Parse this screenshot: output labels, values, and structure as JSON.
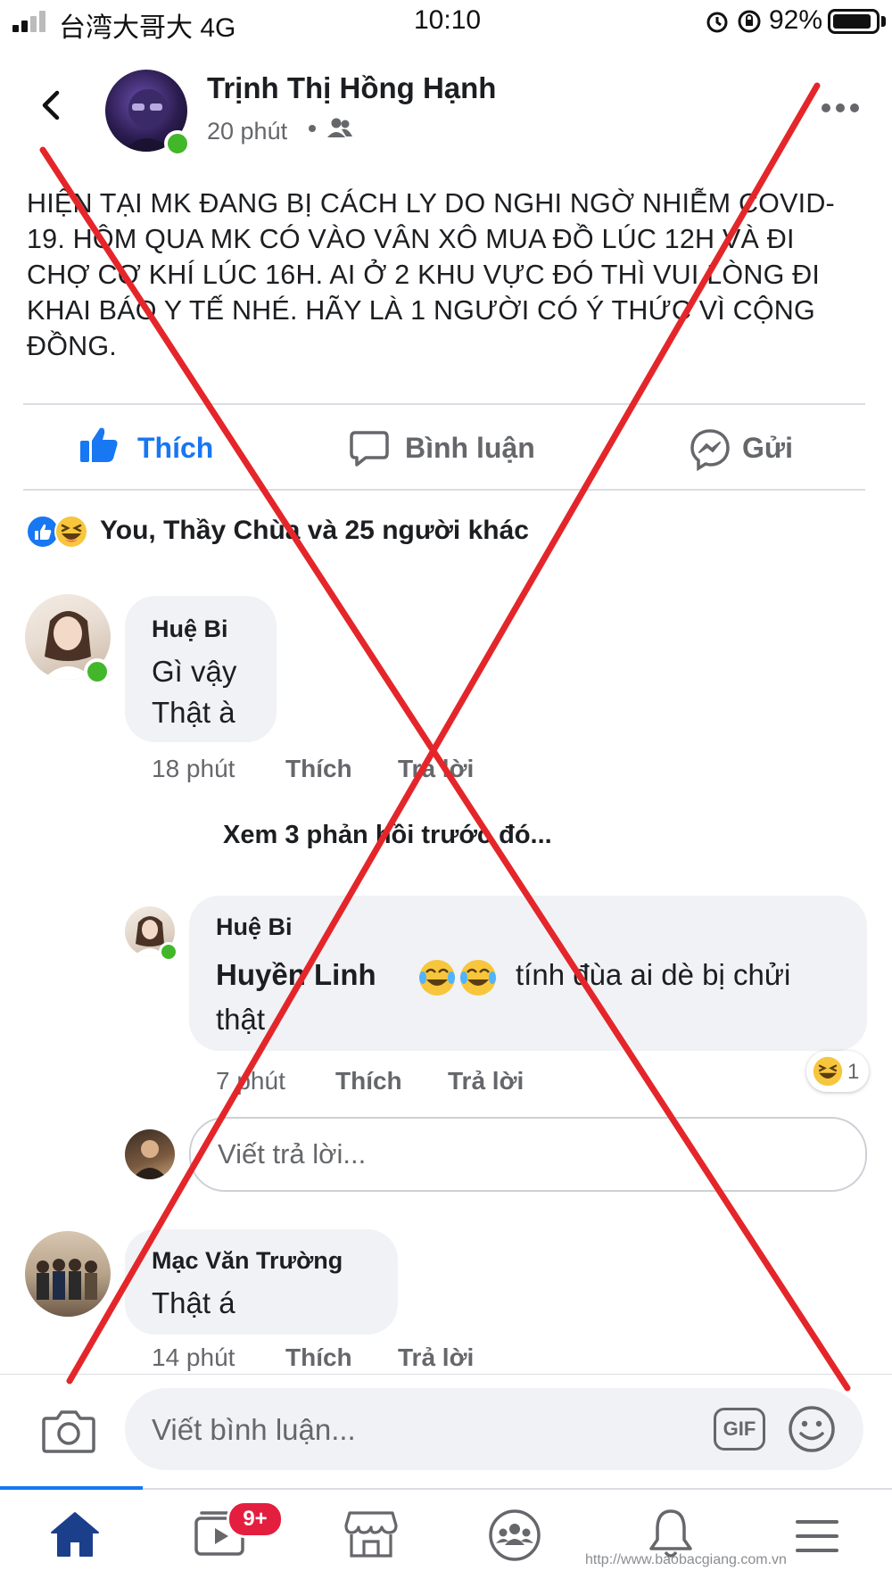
{
  "status_bar": {
    "carrier": "台湾大哥大 4G",
    "time": "10:10",
    "battery": "92%",
    "battery_level": 0.92
  },
  "post": {
    "author": "Trịnh Thị Hồng Hạnh",
    "time": "20 phút",
    "audience_icon": "friends-icon",
    "text": "HIỆN TẠI MK ĐANG BỊ CÁCH LY DO NGHI NGỜ NHIỄM COVID-19. HÔM QUA MK CÓ VÀO VÂN XÔ MUA ĐỒ LÚC 12H VÀ ĐI CHỢ CƠ KHÍ LÚC 16H. AI Ở 2 KHU VỰC ĐÓ THÌ VUI LÒNG ĐI KHAI BÁO Y TẾ NHÉ. HÃY LÀ 1 NGƯỜI CÓ Ý THỨC VÌ CỘNG ĐỒNG."
  },
  "actions": {
    "like": "Thích",
    "comment": "Bình luận",
    "send": "Gửi"
  },
  "reactions": {
    "summary": "You, Thầy Chùa và 25 người khác"
  },
  "comments": [
    {
      "name": "Huệ Bi",
      "lines": [
        "Gì vậy",
        "Thật à"
      ],
      "time": "18 phút",
      "like": "Thích",
      "reply": "Trả lời"
    },
    {
      "name": "Mạc Văn Trường",
      "lines": [
        "Thật á"
      ],
      "time": "14 phút",
      "like": "Thích",
      "reply": "Trả lời"
    }
  ],
  "view_previous": "Xem 3 phản hồi trước đó...",
  "reply": {
    "name": "Huệ Bi",
    "mention": "Huyền Linh",
    "text_after": "tính đùa ai dè bị chửi",
    "text_line2": "thật",
    "time": "7 phút",
    "like": "Thích",
    "reply": "Trả lời",
    "reaction_count": "1"
  },
  "reply_input": {
    "placeholder": "Viết trả lời..."
  },
  "composer": {
    "placeholder": "Viết bình luận...",
    "gif_label": "GIF"
  },
  "bottom_nav": {
    "badge": "9+",
    "items": [
      "home-icon",
      "watch-icon",
      "marketplace-icon",
      "groups-icon",
      "notifications-icon",
      "menu-icon"
    ]
  },
  "watermark": "http://www.baobacgiang.com.vn",
  "colors": {
    "facebook_blue": "#1877f2",
    "cross_red": "#e4262a",
    "online_green": "#42b72a",
    "badge_red": "#e41e3f"
  }
}
